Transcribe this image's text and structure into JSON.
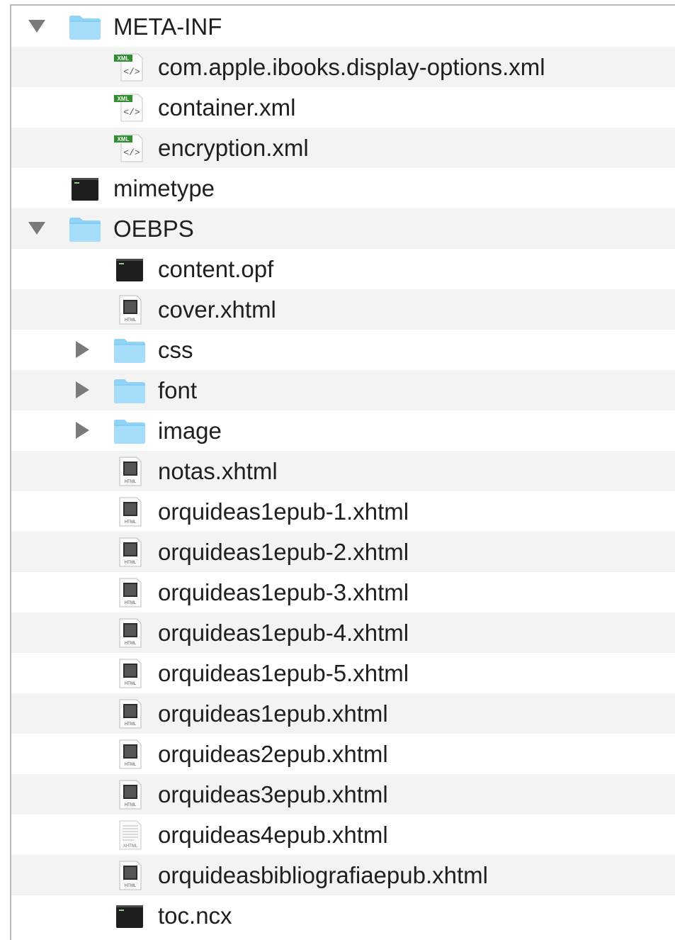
{
  "rows": [
    {
      "name": "META-INF",
      "kind": "folder",
      "level": 0,
      "expand": "down",
      "icon": "folder-icon"
    },
    {
      "name": "com.apple.ibooks.display-options.xml",
      "kind": "xml",
      "level": 1,
      "expand": "none",
      "icon": "xml-file-icon"
    },
    {
      "name": "container.xml",
      "kind": "xml",
      "level": 1,
      "expand": "none",
      "icon": "xml-file-icon"
    },
    {
      "name": "encryption.xml",
      "kind": "xml",
      "level": 1,
      "expand": "none",
      "icon": "xml-file-icon"
    },
    {
      "name": "mimetype",
      "kind": "exec",
      "level": 0,
      "expand": "none",
      "icon": "terminal-exec-icon"
    },
    {
      "name": "OEBPS",
      "kind": "folder",
      "level": 0,
      "expand": "down",
      "icon": "folder-icon"
    },
    {
      "name": "content.opf",
      "kind": "exec",
      "level": 1,
      "expand": "none",
      "icon": "terminal-exec-icon"
    },
    {
      "name": "cover.xhtml",
      "kind": "html",
      "level": 1,
      "expand": "none",
      "icon": "html-file-icon"
    },
    {
      "name": "css",
      "kind": "folder",
      "level": 1,
      "expand": "right",
      "icon": "folder-icon"
    },
    {
      "name": "font",
      "kind": "folder",
      "level": 1,
      "expand": "right",
      "icon": "folder-icon"
    },
    {
      "name": "image",
      "kind": "folder",
      "level": 1,
      "expand": "right",
      "icon": "folder-icon"
    },
    {
      "name": "notas.xhtml",
      "kind": "html",
      "level": 1,
      "expand": "none",
      "icon": "html-file-icon"
    },
    {
      "name": "orquideas1epub-1.xhtml",
      "kind": "html",
      "level": 1,
      "expand": "none",
      "icon": "html-file-icon"
    },
    {
      "name": "orquideas1epub-2.xhtml",
      "kind": "html",
      "level": 1,
      "expand": "none",
      "icon": "html-file-icon"
    },
    {
      "name": "orquideas1epub-3.xhtml",
      "kind": "html",
      "level": 1,
      "expand": "none",
      "icon": "html-file-icon"
    },
    {
      "name": "orquideas1epub-4.xhtml",
      "kind": "html",
      "level": 1,
      "expand": "none",
      "icon": "html-file-icon"
    },
    {
      "name": "orquideas1epub-5.xhtml",
      "kind": "html",
      "level": 1,
      "expand": "none",
      "icon": "html-file-icon"
    },
    {
      "name": "orquideas1epub.xhtml",
      "kind": "html",
      "level": 1,
      "expand": "none",
      "icon": "html-file-icon"
    },
    {
      "name": "orquideas2epub.xhtml",
      "kind": "html",
      "level": 1,
      "expand": "none",
      "icon": "html-file-icon"
    },
    {
      "name": "orquideas3epub.xhtml",
      "kind": "html",
      "level": 1,
      "expand": "none",
      "icon": "html-file-icon"
    },
    {
      "name": "orquideas4epub.xhtml",
      "kind": "xhtml",
      "level": 1,
      "expand": "none",
      "icon": "xhtml-file-icon"
    },
    {
      "name": "orquideasbibliografiaepub.xhtml",
      "kind": "html",
      "level": 1,
      "expand": "none",
      "icon": "html-file-icon"
    },
    {
      "name": "toc.ncx",
      "kind": "exec",
      "level": 1,
      "expand": "none",
      "icon": "terminal-exec-icon"
    }
  ],
  "icon_text": {
    "xml": "XML",
    "html": "HTML",
    "xhtml": "XHTML"
  },
  "colors": {
    "folder": "#8fd4f7",
    "row_alt": "#f3f3f3",
    "xml_badge": "#2f8f2f"
  }
}
